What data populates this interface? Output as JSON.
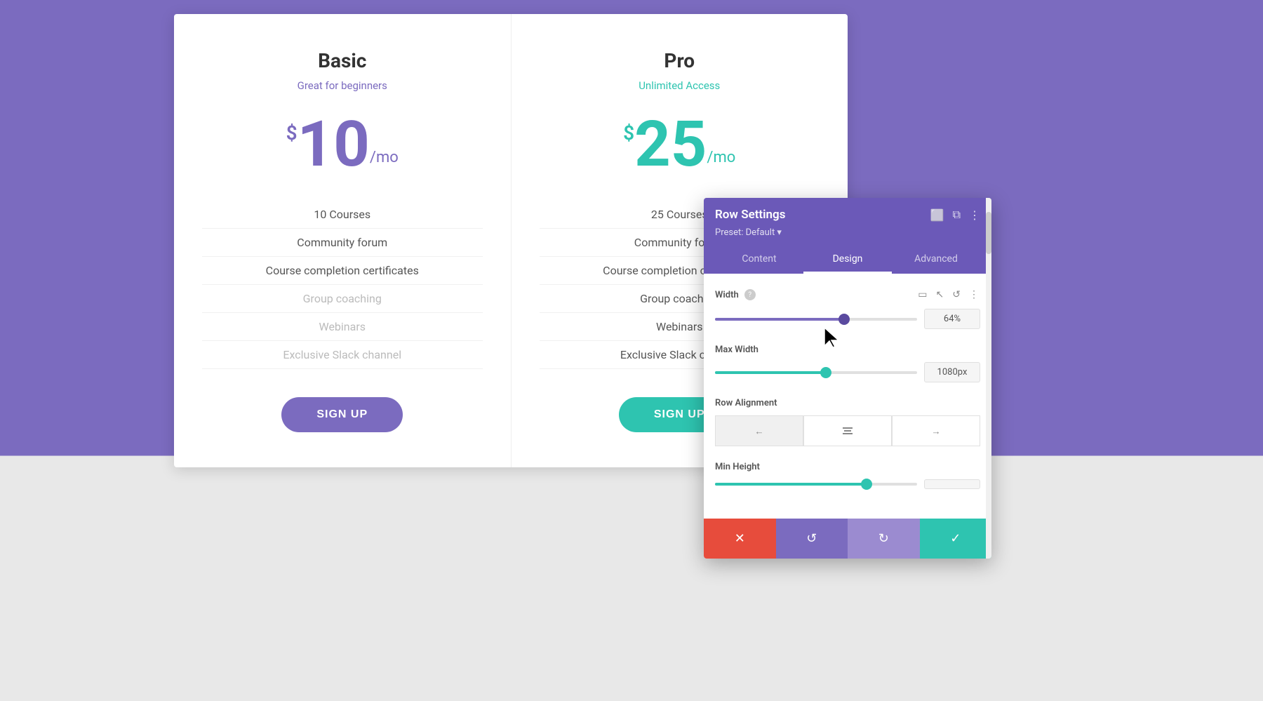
{
  "background": {
    "top_color": "#7b6bbf",
    "bottom_color": "#e8e8e8"
  },
  "pricing": {
    "cards": [
      {
        "id": "basic",
        "title": "Basic",
        "subtitle": "Great for beginners",
        "subtitle_color": "purple",
        "price_symbol": "$",
        "price": "10",
        "period": "/mo",
        "features": [
          {
            "text": "10 Courses",
            "active": true
          },
          {
            "text": "Community forum",
            "active": true
          },
          {
            "text": "Course completion certificates",
            "active": true
          },
          {
            "text": "Group coaching",
            "active": false
          },
          {
            "text": "Webinars",
            "active": false
          },
          {
            "text": "Exclusive Slack channel",
            "active": false
          }
        ],
        "button_label": "SIGN UP",
        "button_color": "purple"
      },
      {
        "id": "pro",
        "title": "Pro",
        "subtitle": "Unlimited Access",
        "subtitle_color": "teal",
        "price_symbol": "$",
        "price": "25",
        "period": "/mo",
        "features": [
          {
            "text": "25 Courses",
            "active": true
          },
          {
            "text": "Community forum",
            "active": true
          },
          {
            "text": "Course completion certificates",
            "active": true
          },
          {
            "text": "Group coaching",
            "active": true
          },
          {
            "text": "Webinars",
            "active": true
          },
          {
            "text": "Exclusive Slack channel",
            "active": true
          }
        ],
        "button_label": "SIGN UP",
        "button_color": "teal"
      }
    ]
  },
  "row_settings": {
    "panel_title": "Row Settings",
    "preset_label": "Preset: Default ▾",
    "tabs": [
      "Content",
      "Design",
      "Advanced"
    ],
    "active_tab": "Design",
    "width_section": {
      "label": "Width",
      "value": "64%",
      "slider_percent": 64
    },
    "max_width_section": {
      "label": "Max Width",
      "value": "1080px",
      "slider_percent": 55
    },
    "row_alignment_section": {
      "label": "Row Alignment",
      "options": [
        "left",
        "center",
        "right"
      ]
    },
    "min_height_section": {
      "label": "Min Height",
      "value": ""
    },
    "footer_buttons": [
      {
        "icon": "✕",
        "color": "red",
        "label": "cancel"
      },
      {
        "icon": "↺",
        "color": "purple",
        "label": "undo"
      },
      {
        "icon": "↻",
        "color": "purple-light",
        "label": "redo"
      },
      {
        "icon": "✓",
        "color": "teal",
        "label": "save"
      }
    ]
  }
}
